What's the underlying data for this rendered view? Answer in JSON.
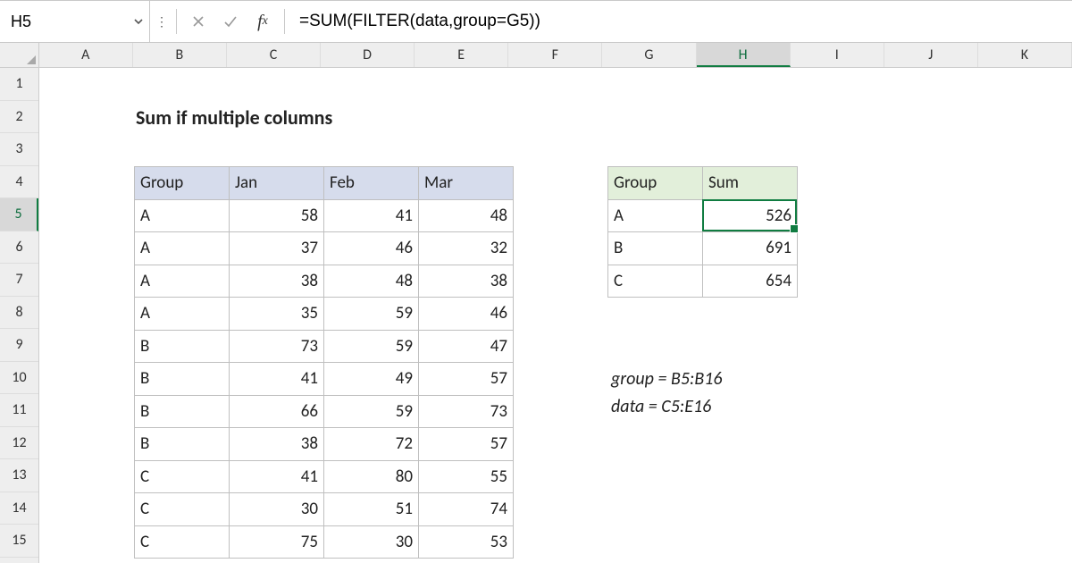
{
  "namebox": "H5",
  "formula": "=SUM(FILTER(data,group=G5))",
  "columns": [
    "A",
    "B",
    "C",
    "D",
    "E",
    "F",
    "G",
    "H",
    "I",
    "J",
    "K"
  ],
  "active_column": "H",
  "rows": [
    "1",
    "2",
    "3",
    "4",
    "5",
    "6",
    "7",
    "8",
    "9",
    "10",
    "11",
    "12",
    "13",
    "14",
    "15"
  ],
  "active_row": "5",
  "title": "Sum if multiple columns",
  "main_headers": [
    "Group",
    "Jan",
    "Feb",
    "Mar"
  ],
  "main_rows": [
    [
      "A",
      58,
      41,
      48
    ],
    [
      "A",
      37,
      46,
      32
    ],
    [
      "A",
      38,
      48,
      38
    ],
    [
      "A",
      35,
      59,
      46
    ],
    [
      "B",
      73,
      59,
      47
    ],
    [
      "B",
      41,
      49,
      57
    ],
    [
      "B",
      66,
      59,
      73
    ],
    [
      "B",
      38,
      72,
      57
    ],
    [
      "C",
      41,
      80,
      55
    ],
    [
      "C",
      30,
      51,
      74
    ],
    [
      "C",
      75,
      30,
      53
    ]
  ],
  "summary_headers": [
    "Group",
    "Sum"
  ],
  "summary_rows": [
    [
      "A",
      526
    ],
    [
      "B",
      691
    ],
    [
      "C",
      654
    ]
  ],
  "notes_line1": "group = B5:B16",
  "notes_line2": "data = C5:E16",
  "chart_data": {
    "type": "table",
    "title": "Sum if multiple columns",
    "source": {
      "columns": [
        "Group",
        "Jan",
        "Feb",
        "Mar"
      ],
      "rows": [
        [
          "A",
          58,
          41,
          48
        ],
        [
          "A",
          37,
          46,
          32
        ],
        [
          "A",
          38,
          48,
          38
        ],
        [
          "A",
          35,
          59,
          46
        ],
        [
          "B",
          73,
          59,
          47
        ],
        [
          "B",
          41,
          49,
          57
        ],
        [
          "B",
          66,
          59,
          73
        ],
        [
          "B",
          38,
          72,
          57
        ],
        [
          "C",
          41,
          80,
          55
        ],
        [
          "C",
          30,
          51,
          74
        ],
        [
          "C",
          75,
          30,
          53
        ]
      ]
    },
    "result": {
      "columns": [
        "Group",
        "Sum"
      ],
      "rows": [
        [
          "A",
          526
        ],
        [
          "B",
          691
        ],
        [
          "C",
          654
        ]
      ]
    },
    "named_ranges": {
      "group": "B5:B16",
      "data": "C5:E16"
    },
    "active_cell_formula": "=SUM(FILTER(data,group=G5))"
  }
}
